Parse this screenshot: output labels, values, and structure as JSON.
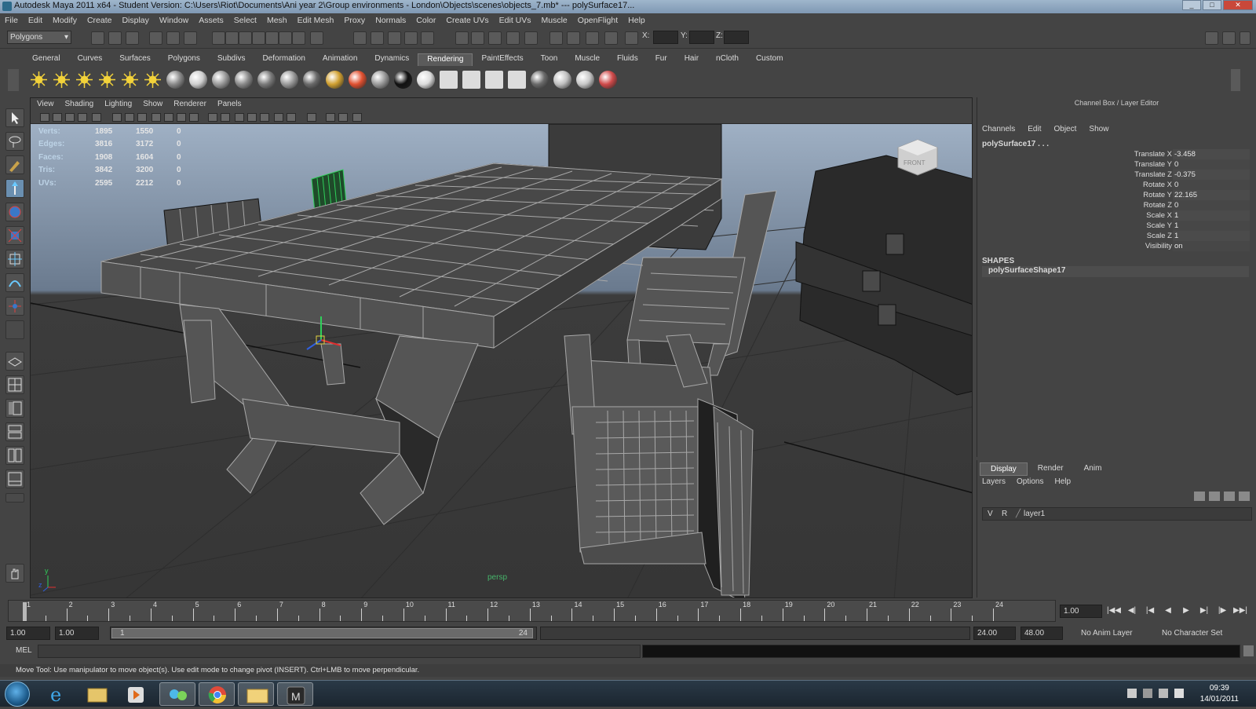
{
  "window": {
    "title": "Autodesk Maya 2011 x64 - Student Version: C:\\Users\\Riot\\Documents\\Ani year 2\\Group environments - London\\Objects\\scenes\\objects_7.mb*  ---  polySurface17..."
  },
  "menubar": [
    "File",
    "Edit",
    "Modify",
    "Create",
    "Display",
    "Window",
    "Assets",
    "Select",
    "Mesh",
    "Edit Mesh",
    "Proxy",
    "Normals",
    "Color",
    "Create UVs",
    "Edit UVs",
    "Muscle",
    "OpenFlight",
    "Help"
  ],
  "status_line": {
    "mode": "Polygons",
    "x_label": "X:",
    "y_label": "Y:",
    "z_label": "Z:"
  },
  "shelf_tabs": [
    "General",
    "Curves",
    "Surfaces",
    "Polygons",
    "Subdivs",
    "Deformation",
    "Animation",
    "Dynamics",
    "Rendering",
    "PaintEffects",
    "Toon",
    "Muscle",
    "Fluids",
    "Fur",
    "Hair",
    "nCloth",
    "Custom"
  ],
  "shelf_active_tab": "Rendering",
  "viewport": {
    "menus": [
      "View",
      "Shading",
      "Lighting",
      "Show",
      "Renderer",
      "Panels"
    ],
    "camera_label": "persp",
    "hud": [
      {
        "label": "Verts:",
        "a": "1895",
        "b": "1550",
        "c": "0"
      },
      {
        "label": "Edges:",
        "a": "3816",
        "b": "3172",
        "c": "0"
      },
      {
        "label": "Faces:",
        "a": "1908",
        "b": "1604",
        "c": "0"
      },
      {
        "label": "Tris:",
        "a": "3842",
        "b": "3200",
        "c": "0"
      },
      {
        "label": "UVs:",
        "a": "2595",
        "b": "2212",
        "c": "0"
      }
    ],
    "viewcube_label": "FRONT",
    "axis": {
      "y": "y",
      "z": "z"
    }
  },
  "channel_box": {
    "title": "Channel Box / Layer Editor",
    "menus": [
      "Channels",
      "Edit",
      "Object",
      "Show"
    ],
    "object_name": "polySurface17 . . .",
    "attributes": [
      {
        "name": "Translate X",
        "value": "-3.458"
      },
      {
        "name": "Translate Y",
        "value": "0"
      },
      {
        "name": "Translate Z",
        "value": "-0.375"
      },
      {
        "name": "Rotate X",
        "value": "0"
      },
      {
        "name": "Rotate Y",
        "value": "22.165"
      },
      {
        "name": "Rotate Z",
        "value": "0"
      },
      {
        "name": "Scale X",
        "value": "1"
      },
      {
        "name": "Scale Y",
        "value": "1"
      },
      {
        "name": "Scale Z",
        "value": "1"
      },
      {
        "name": "Visibility",
        "value": "on"
      }
    ],
    "shapes_label": "SHAPES",
    "shape_name": "polySurfaceShape17"
  },
  "layer_editor": {
    "tabs": [
      "Display",
      "Render",
      "Anim"
    ],
    "active_tab": "Display",
    "menus": [
      "Layers",
      "Options",
      "Help"
    ],
    "layer": {
      "v": "V",
      "r": "R",
      "name": "layer1"
    }
  },
  "timeline": {
    "ticks": [
      "1",
      "2",
      "3",
      "4",
      "5",
      "6",
      "7",
      "8",
      "9",
      "10",
      "11",
      "12",
      "13",
      "14",
      "15",
      "16",
      "17",
      "18",
      "19",
      "20",
      "21",
      "22",
      "23",
      "24"
    ],
    "current_time": "1.00"
  },
  "range": {
    "start_time": "1.00",
    "playback_start": "1.00",
    "slider_start": "1",
    "slider_end": "24",
    "playback_end": "24.00",
    "end_time": "48.00",
    "anim_layer": "No Anim Layer",
    "character_set": "No Character Set"
  },
  "command_line": {
    "label": "MEL"
  },
  "help_line": "Move Tool: Use manipulator to move object(s). Use edit mode to change pivot (INSERT). Ctrl+LMB to move perpendicular.",
  "taskbar": {
    "time": "09:39",
    "date": "14/01/2011"
  },
  "colors": {
    "viewport_bg": "#3a3a3a",
    "ui_bg": "#444444",
    "wire": "#a8a8a8",
    "selection_green": "#2fd05a"
  }
}
